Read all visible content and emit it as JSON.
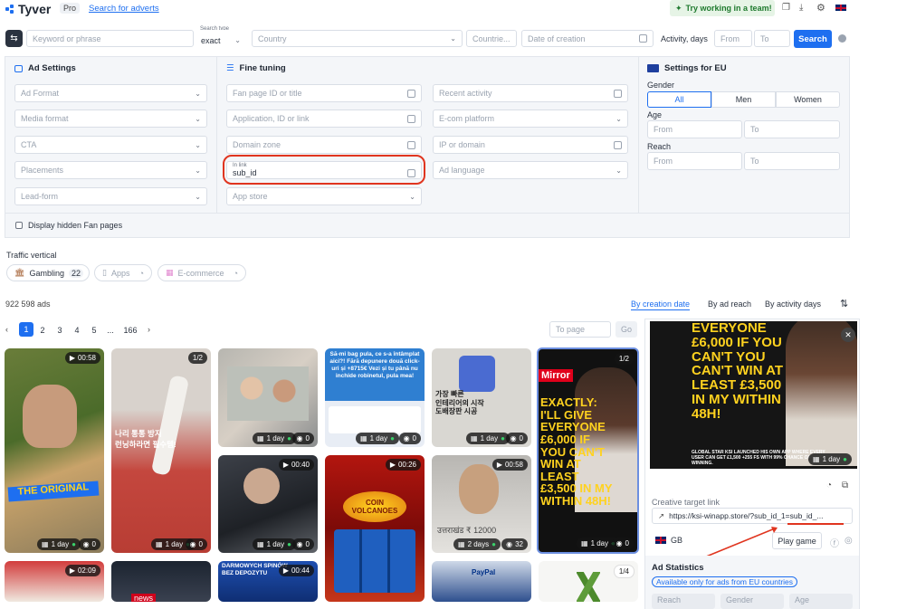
{
  "header": {
    "logo": "Tyver",
    "plan_badge": "Pro",
    "search_link": "Search for adverts",
    "team_button": "Try working in a team!"
  },
  "searchbar": {
    "keyword_placeholder": "Keyword or phrase",
    "search_type_label": "Search type",
    "search_type_value": "exact",
    "country_placeholder": "Country",
    "countries_placeholder": "Countrie...",
    "date_placeholder": "Date of creation",
    "activity_label": "Activity, days",
    "from": "From",
    "to": "To",
    "search_button": "Search"
  },
  "ad_settings": {
    "title": "Ad Settings",
    "fields": [
      "Ad Format",
      "Media format",
      "CTA",
      "Placements",
      "Lead-form"
    ],
    "display_hidden": "Display hidden Fan pages"
  },
  "fine_tuning": {
    "title": "Fine tuning",
    "col1": [
      "Fan page ID or title",
      "Application, ID or link",
      "Domain zone"
    ],
    "in_link_label": "In link",
    "in_link_value": "sub_id",
    "app_store": "App store",
    "col2": [
      "Recent activity",
      "E-com platform",
      "IP or domain",
      "Ad language"
    ]
  },
  "eu_settings": {
    "title": "Settings for EU",
    "gender_label": "Gender",
    "gender_options": [
      "All",
      "Men",
      "Women"
    ],
    "age_label": "Age",
    "reach_label": "Reach",
    "from": "From",
    "to": "To"
  },
  "traffic": {
    "label": "Traffic vertical",
    "chips": [
      {
        "label": "Gambling",
        "count": "22"
      },
      {
        "label": "Apps",
        "count": ""
      },
      {
        "label": "E-commerce",
        "count": ""
      }
    ]
  },
  "results": {
    "count": "922 598 ads",
    "sort_options": [
      "By creation date",
      "By ad reach",
      "By activity days"
    ],
    "pages": [
      "1",
      "2",
      "3",
      "4",
      "5",
      "...",
      "166"
    ],
    "to_page_placeholder": "To page",
    "go": "Go"
  },
  "cards": [
    {
      "top": "00:58",
      "days": "1 day",
      "views": "0"
    },
    {
      "top": "1/2",
      "days": "1 day",
      "views": "0",
      "mid_text": "나리 통통 방지\n런닝하라면 필수템!"
    },
    {
      "top": "",
      "days": "1 day",
      "views": "0"
    },
    {
      "top": "",
      "days": "1 day",
      "views": "0",
      "mid_text": "Să-mi bag pula, ce s-a întâmplat aici?! Fără depunere două click-uri și +8715€ Vezi și tu până nu inchide robinetul, pula mea!"
    },
    {
      "top": "",
      "days": "1 day",
      "views": "0",
      "mid_text": "가장 빠른\n인테리어의 시작\n도배장판 시공"
    },
    {
      "top": "1/2",
      "days": "1 day",
      "views": "0",
      "mid_text": "EXACTLY: I'LL GIVE EVERYONE £6,000 IF YOU CAN'T WIN AT LEAST £3,500 IN MY WITHIN 48H!"
    },
    {
      "top": "",
      "days": "1 day",
      "views": "0"
    },
    {
      "top": "00:40",
      "days": "1 day",
      "views": "0"
    },
    {
      "top": "00:26",
      "days": "",
      "views": "",
      "mid_text": "COIN VOLCANOES"
    },
    {
      "top": "00:58",
      "days": "2 days",
      "views": "32",
      "mid_text": "उत्तराखंड ₹ 12000"
    },
    {
      "top": "02:09",
      "days": "",
      "views": ""
    },
    {
      "top": "",
      "days": "",
      "views": "",
      "mid_text": "news"
    },
    {
      "top": "00:44",
      "days": "",
      "views": "",
      "mid_text": "DARMOWYCH SPINÓW BEZ DEPOZYTU"
    },
    {
      "top": "",
      "days": "",
      "views": "",
      "mid_text": "PayPal"
    },
    {
      "top": "1/4",
      "days": "",
      "views": ""
    }
  ],
  "detail": {
    "hero_text": "EVERYONE £6,000 IF YOU CAN'T YOU CAN'T WIN AT LEAST £3,500 IN MY WITHIN 48H!",
    "hero_caption": "GLOBAL STAR KSI LAUNCHED HIS OWN APP WHERE EVERY USER CAN GET £1,500 +255 FS WITH 99% CHANCE OF WINNING.",
    "hero_days": "1 day",
    "target_label": "Creative target link",
    "target_link": "https://ksi-winapp.store/?sub_id_1=sub_id_...",
    "country": "GB",
    "play_button": "Play game",
    "stats_title": "Ad Statistics",
    "stats_note": "Available only for ads from EU countries",
    "stat_cols": [
      "Reach",
      "Gender",
      "Age"
    ]
  },
  "colors": {
    "accent": "#1e6ff0",
    "highlight": "#e0351f",
    "panel": "#f4f6f9"
  }
}
